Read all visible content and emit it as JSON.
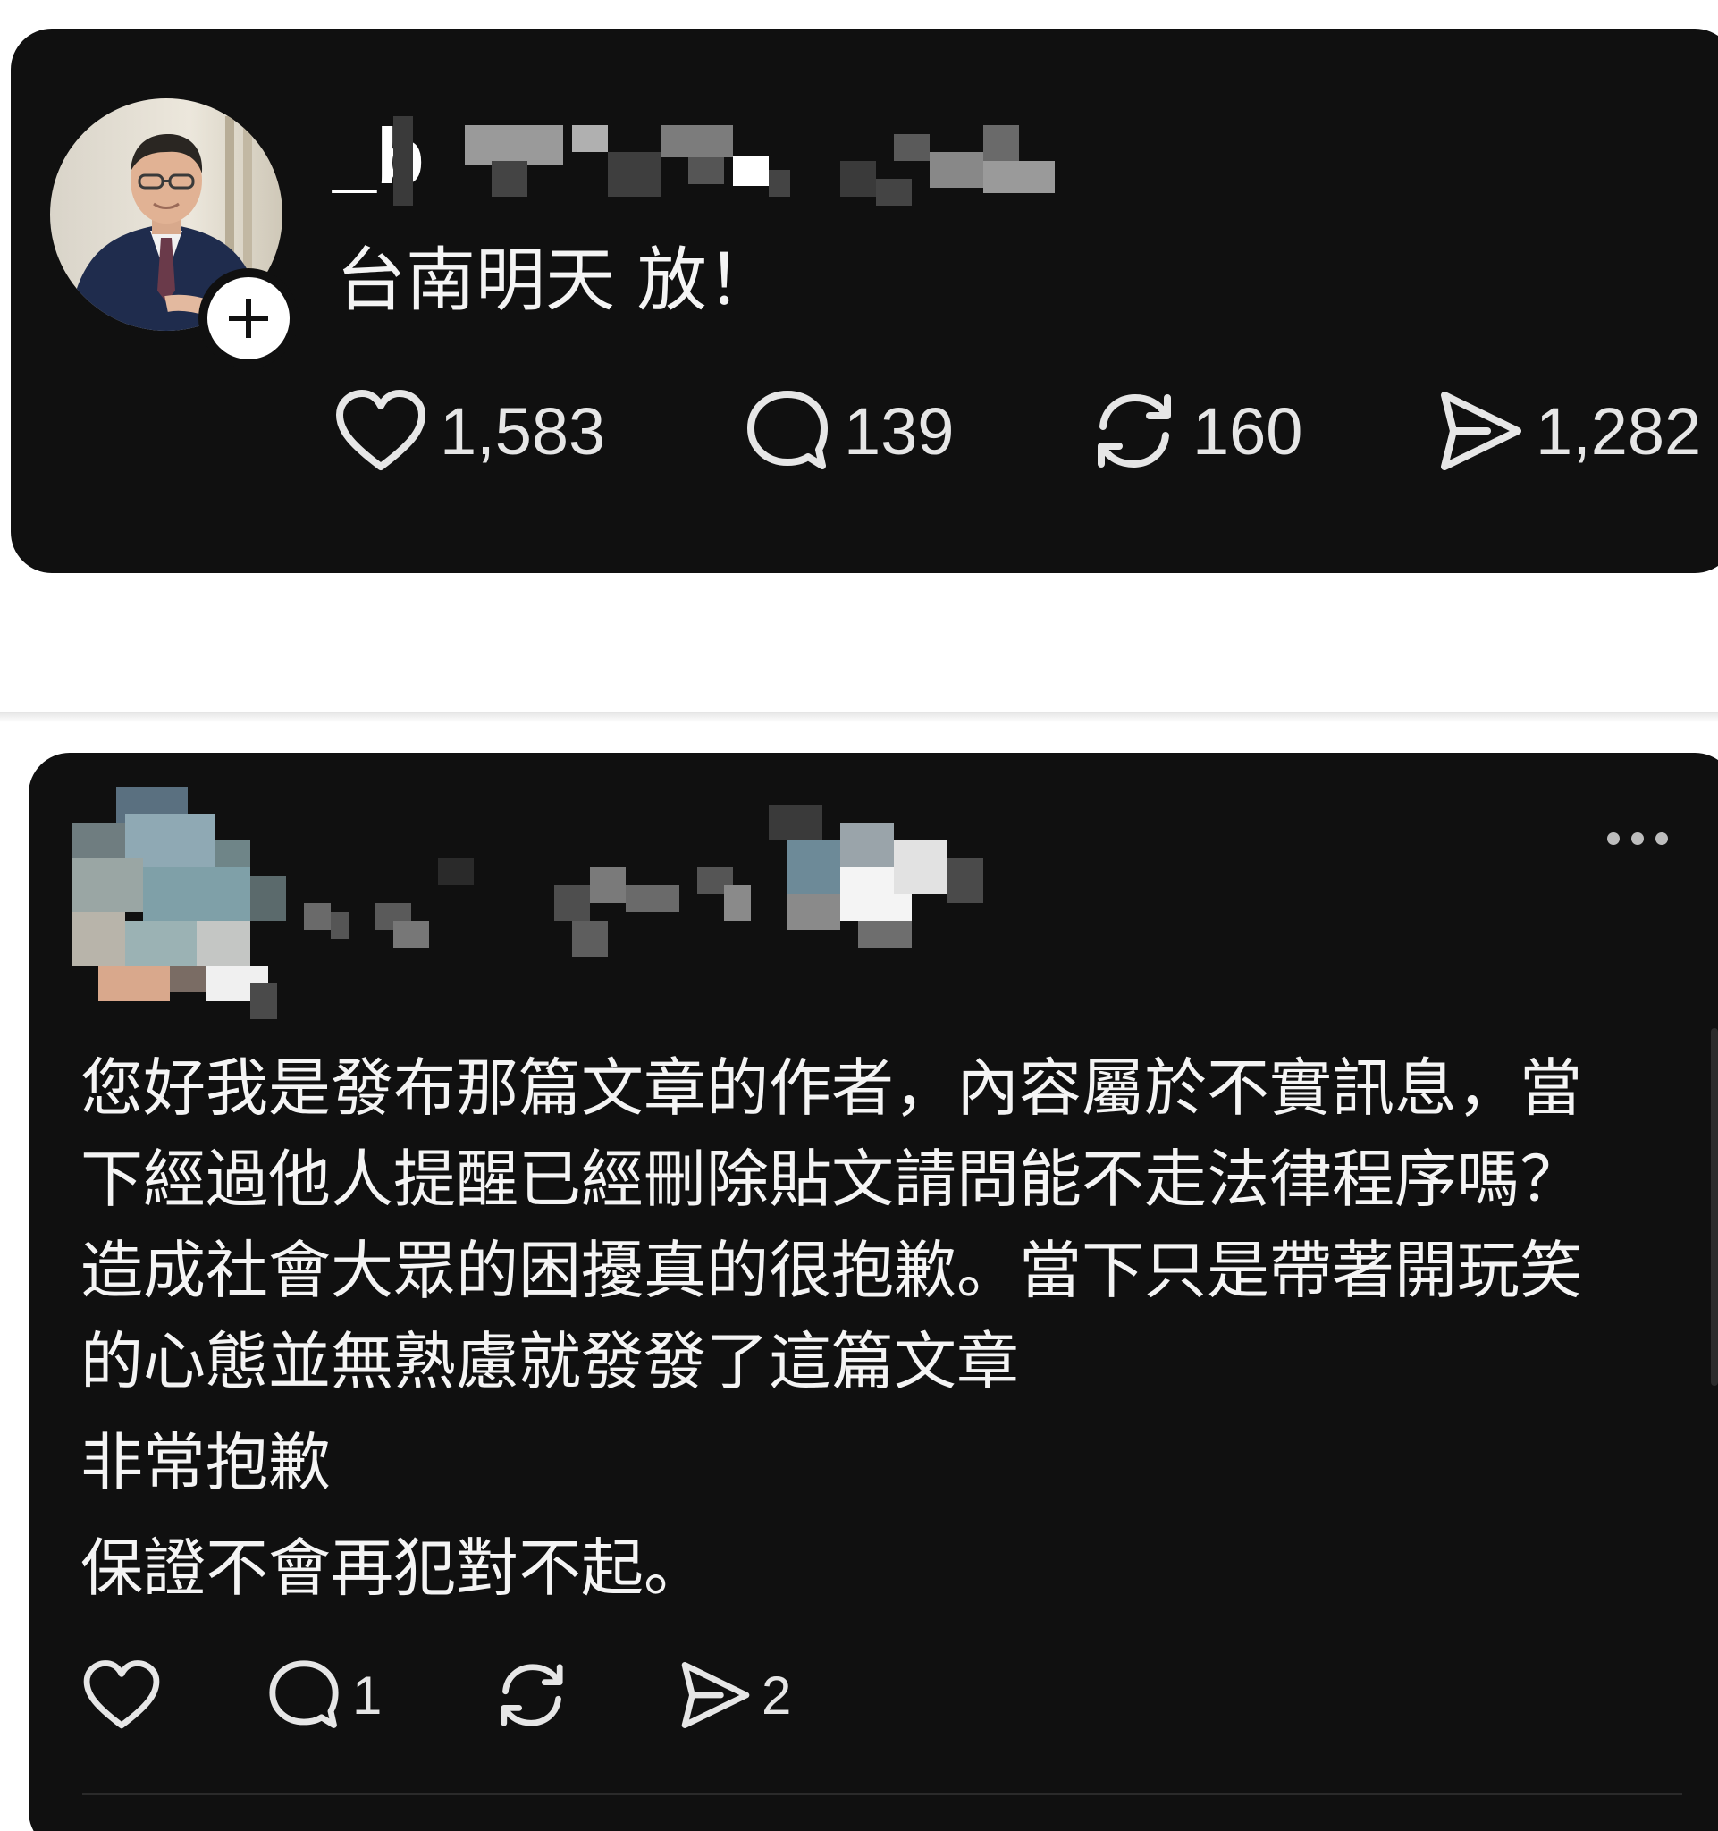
{
  "post": {
    "username_visible": "_b",
    "text": "台南明天 放！",
    "likes": "1,583",
    "replies": "139",
    "reposts": "160",
    "shares": "1,282"
  },
  "reply": {
    "paragraphs": [
      "您好我是發布那篇文章的作者，內容屬於不實訊息，當下經過他人提醒已經刪除貼文請問能不走法律程序嗎？造成社會大眾的困擾真的很抱歉。當下只是帶著開玩笑的心態並無熟慮就發發了這篇文章",
      "非常抱歉",
      "保證不會再犯對不起。"
    ],
    "line_breaks": [
      "您好我是發布那篇文章的作者，內容屬於不實訊息，當",
      "下經過他人提醒已經刪除貼文請問能不走法律程序嗎？",
      "造成社會大眾的困擾真的很抱歉。當下只是帶著開玩笑",
      "的心態並無熟慮就發發了這篇文章"
    ],
    "replies": "1",
    "shares": "2"
  },
  "icons": {
    "like": "heart-icon",
    "reply": "comment-icon",
    "repost": "repost-icon",
    "share": "send-icon",
    "follow": "plus-icon",
    "more": "more-icon"
  },
  "colors": {
    "card_background": "#101010",
    "page_background": "#ffffff",
    "text": "#f2f2f2"
  }
}
